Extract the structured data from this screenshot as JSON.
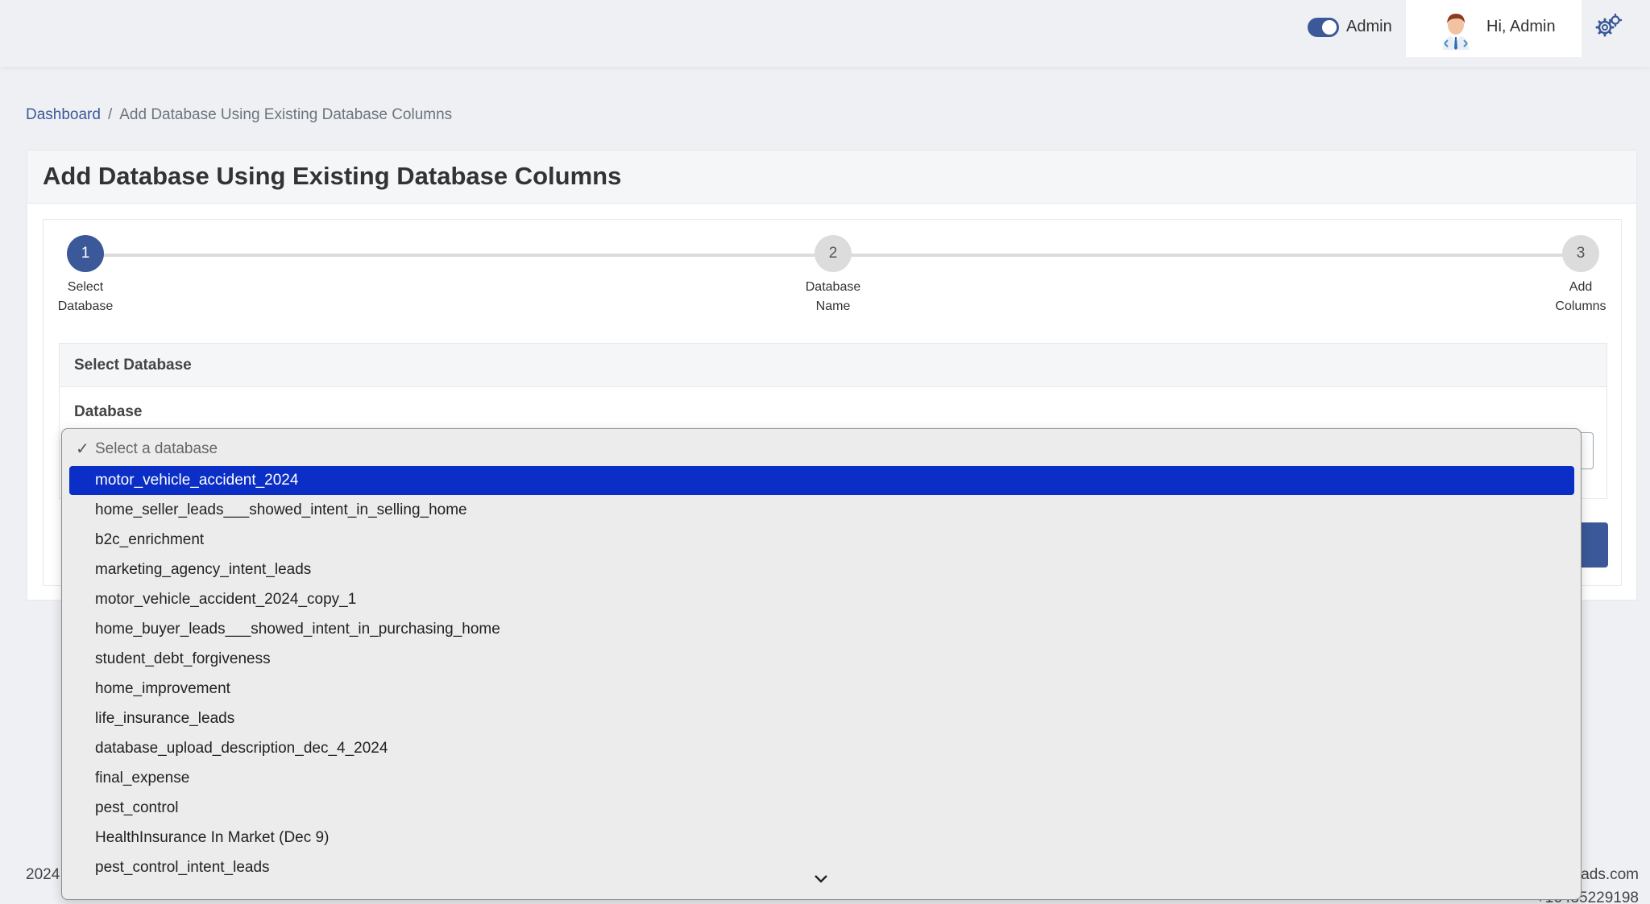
{
  "header": {
    "toggle_label": "Admin",
    "greeting": "Hi, Admin"
  },
  "breadcrumb": {
    "home": "Dashboard",
    "separator": "/",
    "current": "Add Database Using Existing Database Columns"
  },
  "page": {
    "title": "Add Database Using Existing Database Columns"
  },
  "stepper": {
    "steps": [
      {
        "number": "1",
        "label_line1": "Select",
        "label_line2": "Database",
        "active": true
      },
      {
        "number": "2",
        "label_line1": "Database",
        "label_line2": "Name",
        "active": false
      },
      {
        "number": "3",
        "label_line1": "Add",
        "label_line2": "Columns",
        "active": false
      }
    ]
  },
  "section": {
    "title": "Select Database",
    "field_label": "Database"
  },
  "dropdown": {
    "placeholder": "Select a database",
    "selected": "motor_vehicle_accident_2024",
    "options": [
      "motor_vehicle_accident_2024",
      "home_seller_leads___showed_intent_in_selling_home",
      "b2c_enrichment",
      "marketing_agency_intent_leads",
      "motor_vehicle_accident_2024_copy_1",
      "home_buyer_leads___showed_intent_in_purchasing_home",
      "student_debt_forgiveness",
      "home_improvement",
      "life_insurance_leads",
      "database_upload_description_dec_4_2024",
      "final_expense",
      "pest_control",
      "HealthInsurance In Market (Dec 9)",
      "pest_control_intent_leads"
    ]
  },
  "footer": {
    "left": "2024",
    "right": "ads.com",
    "phone": "+16435229198"
  },
  "colors": {
    "primary": "#3b5998",
    "selected_option": "#0a2ec6"
  }
}
